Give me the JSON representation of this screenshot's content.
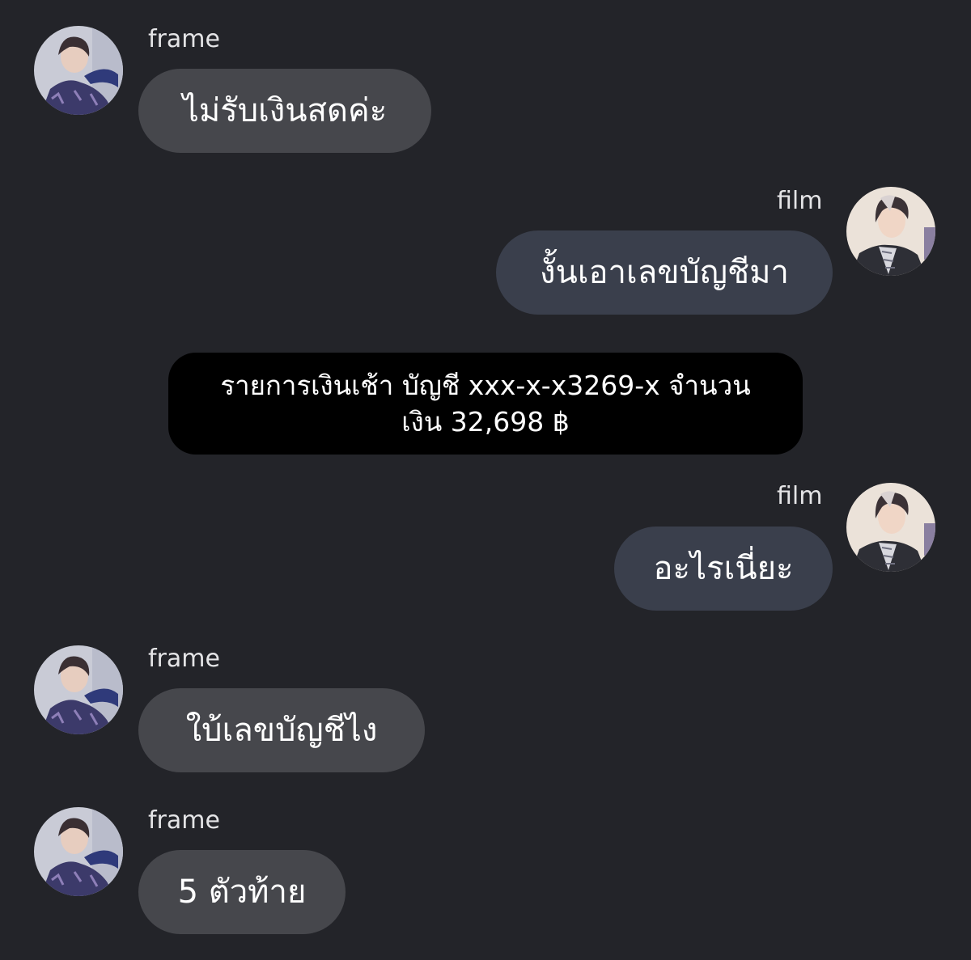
{
  "colors": {
    "background": "#232429",
    "incoming_bubble": "#46474c",
    "outgoing_bubble": "#3a3f4c",
    "notice_bubble": "#000000",
    "text": "#ffffff",
    "sender_name": "#e4e4e6"
  },
  "messages": [
    {
      "direction": "incoming",
      "sender": "frame",
      "avatar_icon": "frame-avatar-photo",
      "text": "ไม่รับเงินสดค่ะ"
    },
    {
      "direction": "outgoing",
      "sender": "film",
      "avatar_icon": "film-avatar-photo",
      "text": "งั้นเอาเลขบัญชีมา"
    },
    {
      "direction": "system",
      "lines": [
        "รายการเงินเช้า บัญชี xxx-x-x3269-x จำนวน",
        "เงิน 32,698 ฿"
      ]
    },
    {
      "direction": "outgoing",
      "sender": "film",
      "avatar_icon": "film-avatar-photo",
      "text": "อะไรเนี่ยะ"
    },
    {
      "direction": "incoming",
      "sender": "frame",
      "avatar_icon": "frame-avatar-photo",
      "text": "ใบ้เลขบัญชีไง"
    },
    {
      "direction": "incoming",
      "sender": "frame",
      "avatar_icon": "frame-avatar-photo",
      "text": "5 ตัวท้าย"
    }
  ]
}
